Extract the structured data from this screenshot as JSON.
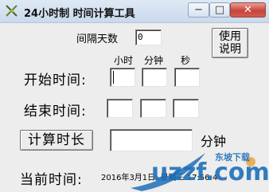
{
  "window": {
    "title": "24小时制 时间计算工具",
    "minimize_glyph": "−",
    "maximize_glyph": "□",
    "close_glyph": "✕"
  },
  "interval": {
    "label": "间隔天数",
    "value": "0"
  },
  "help_button": {
    "line1": "使用",
    "line2": "说明"
  },
  "columns": {
    "hour": "小时",
    "minute": "分钟",
    "second": "秒"
  },
  "start": {
    "label": "开始时间:",
    "hour": "",
    "minute": "",
    "second": ""
  },
  "end": {
    "label": "结束时间:",
    "hour": "",
    "minute": "",
    "second": ""
  },
  "calc": {
    "button_label": "计算时长",
    "result": "",
    "unit": "分钟"
  },
  "current": {
    "label": "当前时间:",
    "value": "2016年3月1日, 星期三 17:56:4"
  },
  "watermark": {
    "text": "东坡下载",
    "logo": "uzzf.com"
  }
}
